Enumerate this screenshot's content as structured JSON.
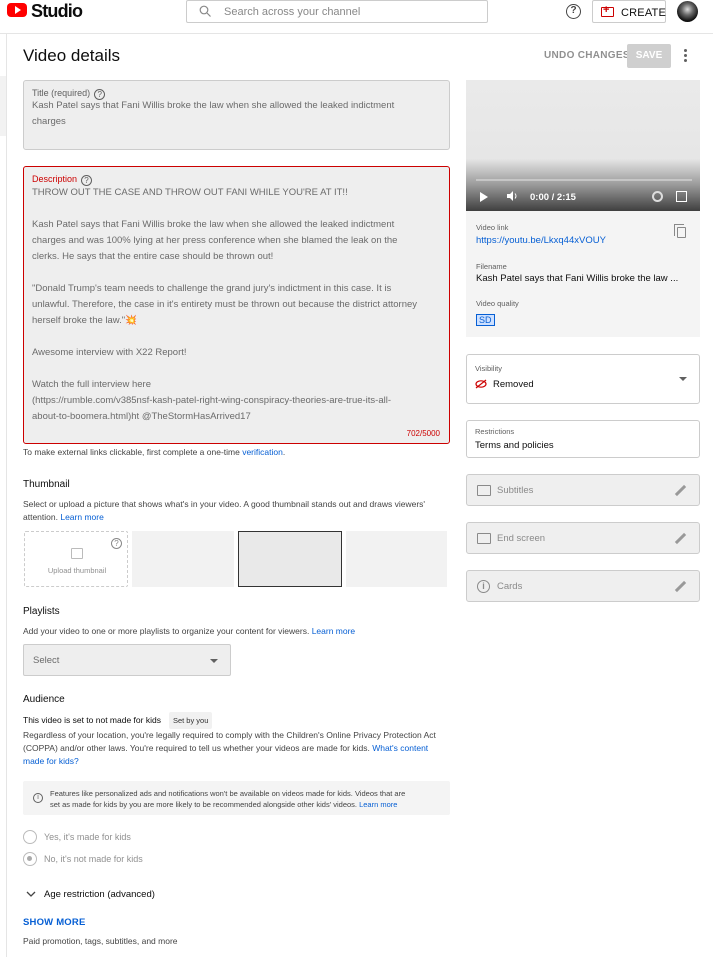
{
  "app": {
    "brand": "Studio",
    "search_placeholder": "Search across your channel",
    "create_label": "CREATE",
    "help_symbol": "?"
  },
  "header": {
    "title": "Video details",
    "undo_label": "UNDO CHANGES",
    "save_label": "SAVE"
  },
  "title_field": {
    "label": "Title (required)",
    "value_line1": "Kash Patel says that Fani Willis broke the law when she allowed the leaked indictment",
    "value_line2": "charges"
  },
  "description_field": {
    "label": "Description",
    "lines": [
      "THROW OUT THE CASE AND THROW OUT FANI WHILE YOU'RE AT IT!!",
      "",
      "Kash Patel says that Fani Willis broke the law when she allowed the leaked indictment",
      "charges and was 100% lying at her press conference when she blamed the leak on the",
      "clerks. He says that the entire case should be thrown out!",
      "",
      "\"Donald Trump's team needs to challenge the grand jury's indictment in this case. It is",
      "unlawful. Therefore, the case in it's entirety must be thrown out because the district attorney",
      "herself broke the law.\"💥",
      "",
      "Awesome interview with X22 Report!",
      "",
      "Watch the full interview here",
      " (https://rumble.com/v385nsf-kash-patel-right-wing-conspiracy-theories-are-true-its-all-",
      "about-to-boomera.html)ht @TheStormHasArrived17"
    ],
    "counter": "702/5000"
  },
  "links_note": {
    "text": "To make external links clickable, first complete a one-time ",
    "link": "verification",
    "end": "."
  },
  "thumbnail": {
    "title": "Thumbnail",
    "text1": "Select or upload a picture that shows what's in your video. A good thumbnail stands out and draws viewers'",
    "text2": "attention. ",
    "learn_more": "Learn more",
    "upload_label": "Upload thumbnail"
  },
  "playlists": {
    "title": "Playlists",
    "text": "Add your video to one or more playlists to organize your content for viewers. ",
    "learn_more": "Learn more",
    "select_value": "Select"
  },
  "audience": {
    "title": "Audience",
    "status": "This video is set to not made for kids",
    "badge": "Set by you",
    "text1": "Regardless of your location, you're legally required to comply with the Children's Online Privacy Protection Act",
    "text2": "(COPPA) and/or other laws. You're required to tell us whether your videos are made for kids. ",
    "link_a": "What's content",
    "link_b": "made for kids?",
    "info1": "Features like personalized ads and notifications won't be available on videos made for kids. Videos that are",
    "info2": "set as made for kids by you are more likely to be recommended alongside other kids' videos. ",
    "info_link": "Learn more",
    "option_yes": "Yes, it's made for kids",
    "option_no": "No, it's not made for kids",
    "selected": "no"
  },
  "age_restriction": "Age restriction (advanced)",
  "show_more": {
    "label": "SHOW MORE",
    "sub": "Paid promotion, tags, subtitles, and more"
  },
  "player": {
    "time": "0:00 / 2:15",
    "progress": 0
  },
  "video_info": {
    "link_label": "Video link",
    "link": "https://youtu.be/Lkxq44xVOUY",
    "filename_label": "Filename",
    "filename": "Kash Patel says that Fani Willis broke the law ...",
    "quality_label": "Video quality",
    "quality": "SD"
  },
  "visibility": {
    "label": "Visibility",
    "value": "Removed"
  },
  "restrictions": {
    "label": "Restrictions",
    "value": "Terms and policies"
  },
  "editors": {
    "subtitles": "Subtitles",
    "end_screen": "End screen",
    "cards": "Cards"
  },
  "colors": {
    "accent": "#065fd4",
    "error": "#cc0000",
    "brand": "#ff0000"
  }
}
